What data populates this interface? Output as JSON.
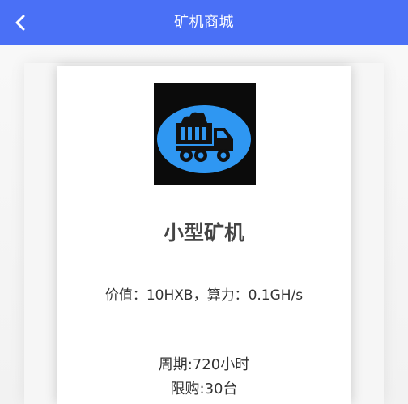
{
  "header": {
    "title": "矿机商城",
    "back_icon": "chevron-left-icon",
    "background_color": "#4a70f6"
  },
  "product": {
    "image_icon": "dump-truck-icon",
    "name": "小型矿机",
    "value_text": "价值：10HXB，算力：0.1GH/s",
    "period_text": "周期:720小时",
    "limit_text": "限购:30台"
  }
}
